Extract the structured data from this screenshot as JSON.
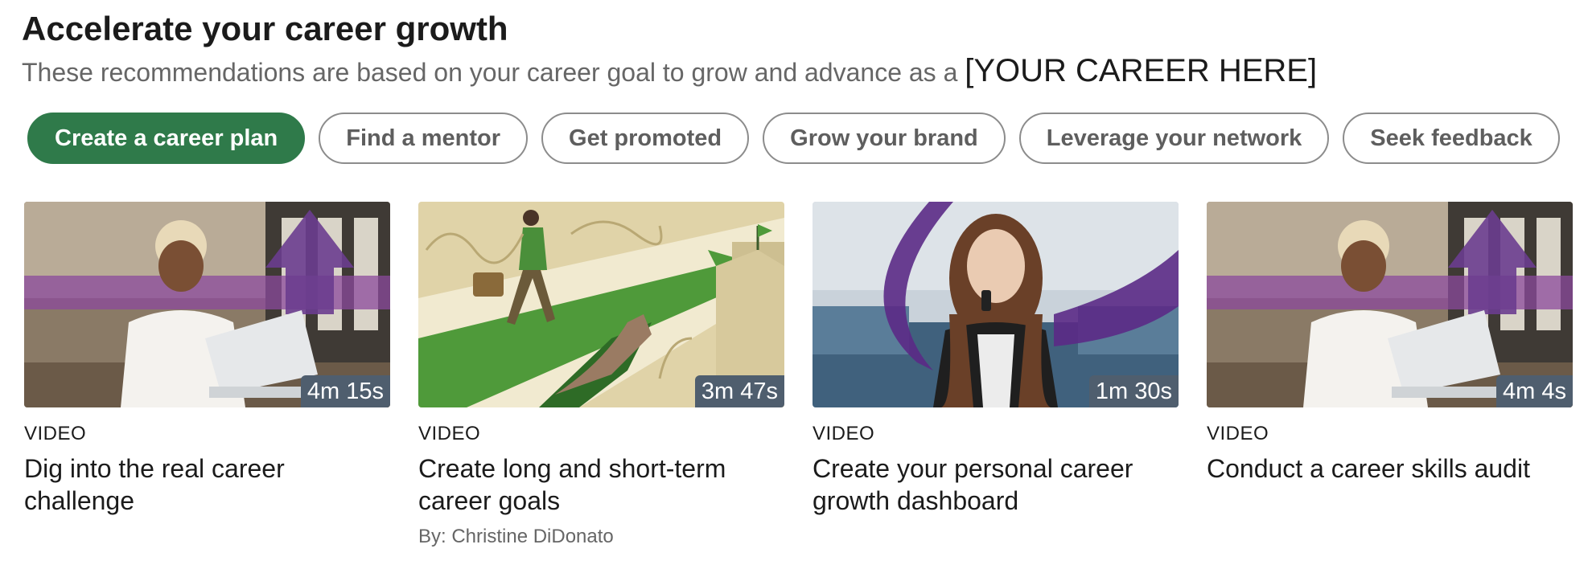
{
  "header": {
    "title": "Accelerate your career growth",
    "subtitle": "These recommendations are based on your career goal to grow and advance as a",
    "career_placeholder": "[YOUR CAREER HERE]"
  },
  "filters": [
    {
      "label": "Create a career plan",
      "active": true
    },
    {
      "label": "Find a mentor",
      "active": false
    },
    {
      "label": "Get promoted",
      "active": false
    },
    {
      "label": "Grow your brand",
      "active": false
    },
    {
      "label": "Leverage your network",
      "active": false
    },
    {
      "label": "Seek feedback",
      "active": false
    }
  ],
  "cards": [
    {
      "type": "VIDEO",
      "duration": "4m 15s",
      "title": "Dig into the real career challenge",
      "author": ""
    },
    {
      "type": "VIDEO",
      "duration": "3m 47s",
      "title": "Create long and short-term career goals",
      "author": "By: Christine DiDonato"
    },
    {
      "type": "VIDEO",
      "duration": "1m 30s",
      "title": "Create your personal career growth dashboard",
      "author": ""
    },
    {
      "type": "VIDEO",
      "duration": "4m 4s",
      "title": "Conduct a career skills audit",
      "author": ""
    }
  ],
  "colors": {
    "active_pill": "#2f7a4a",
    "accent_purple": "#6a3d8f",
    "duration_badge": "#4f5e6e"
  }
}
